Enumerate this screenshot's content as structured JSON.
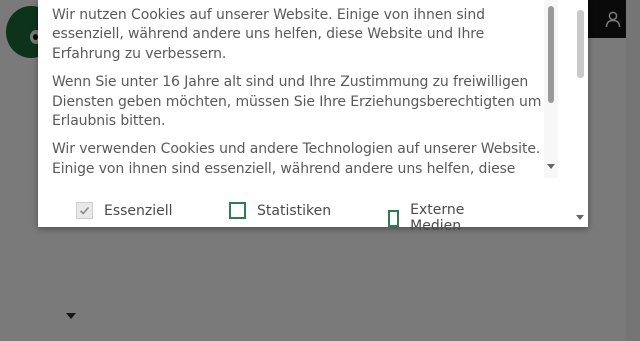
{
  "header": {
    "icons": [
      "logo-icon",
      "box-icon",
      "star-icon",
      "search-icon",
      "user-icon"
    ]
  },
  "cookie_dialog": {
    "paragraphs": [
      "Wir nutzen Cookies auf unserer Website. Einige von ihnen sind essenziell, während andere uns helfen, diese Website und Ihre Erfahrung zu verbessern.",
      "Wenn Sie unter 16 Jahre alt sind und Ihre Zustimmung zu freiwilligen Diensten geben möchten, müssen Sie Ihre Erziehungsberechtigten um Erlaubnis bitten.",
      "Wir verwenden Cookies und andere Technologien auf unserer Website. Einige von ihnen sind essenziell, während andere uns helfen, diese"
    ],
    "options": [
      {
        "label": "Essenziell",
        "checked": true,
        "disabled": true
      },
      {
        "label": "Statistiken",
        "checked": false,
        "disabled": false
      },
      {
        "label": "Externe Medien",
        "checked": false,
        "disabled": false
      }
    ]
  },
  "colors": {
    "accent": "#2e7d4f",
    "overlay": "rgba(0,0,0,0.52)",
    "text": "#5a5a5a"
  }
}
